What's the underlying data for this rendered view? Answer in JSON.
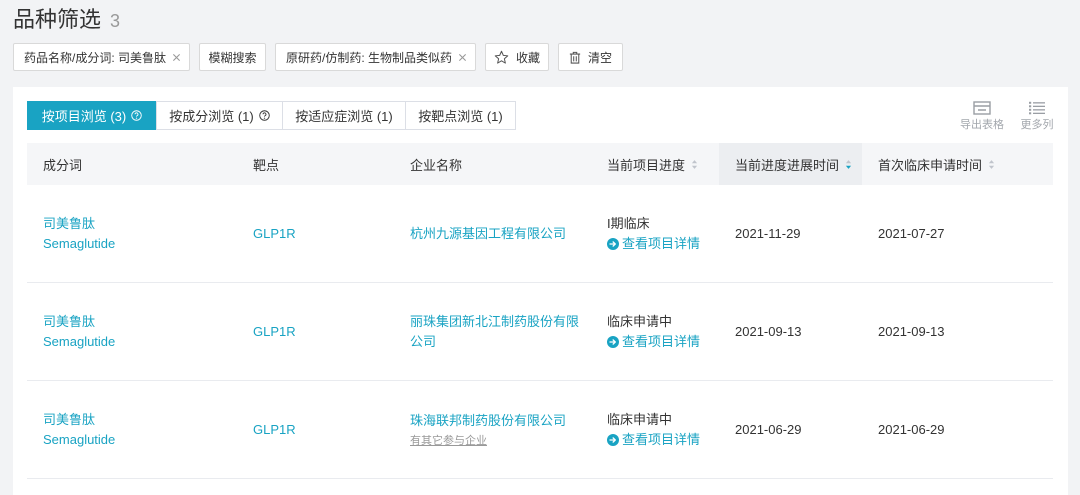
{
  "header": {
    "title": "品种筛选",
    "count": "3"
  },
  "filters": {
    "drug_name": {
      "label": "药品名称/成分词: 司美鲁肽"
    },
    "fuzzy_search_label": "模糊搜索",
    "originator_generic": {
      "label": "原研药/仿制药: 生物制品类似药"
    },
    "favorite_label": "收藏",
    "clear_label": "清空"
  },
  "tabs": [
    {
      "label": "按项目浏览 (3)",
      "active": true
    },
    {
      "label": "按成分浏览 (1)",
      "active": false
    },
    {
      "label": "按适应症浏览 (1)",
      "active": false
    },
    {
      "label": "按靶点浏览 (1)",
      "active": false
    }
  ],
  "tools": {
    "export_label": "导出表格",
    "more_columns_label": "更多列"
  },
  "table": {
    "columns": [
      {
        "label": "成分词",
        "sortable": false
      },
      {
        "label": "靶点",
        "sortable": false
      },
      {
        "label": "企业名称",
        "sortable": false
      },
      {
        "label": "当前项目进度",
        "sortable": true,
        "sorted_desc": false
      },
      {
        "label": "当前进度进展时间",
        "sortable": true,
        "sorted_desc": true
      },
      {
        "label": "首次临床申请时间",
        "sortable": true,
        "sorted_desc": false
      }
    ],
    "rows": [
      {
        "name_cn": "司美鲁肽",
        "name_en": "Semaglutide",
        "target": "GLP1R",
        "company": "杭州九源基因工程有限公司",
        "progress": "I期临床",
        "detail_link": "查看项目详情",
        "progress_date": "2021-11-29",
        "first_application_date": "2021-07-27"
      },
      {
        "name_cn": "司美鲁肽",
        "name_en": "Semaglutide",
        "target": "GLP1R",
        "company": "丽珠集团新北江制药股份有限公司",
        "progress": "临床申请中",
        "detail_link": "查看项目详情",
        "progress_date": "2021-09-13",
        "first_application_date": "2021-09-13"
      },
      {
        "name_cn": "司美鲁肽",
        "name_en": "Semaglutide",
        "target": "GLP1R",
        "company": "珠海联邦制药股份有限公司",
        "company_note": "有其它参与企业",
        "progress": "临床申请中",
        "detail_link": "查看项目详情",
        "progress_date": "2021-06-29",
        "first_application_date": "2021-06-29"
      }
    ]
  },
  "colors": {
    "accent": "#19a3c3",
    "text": "#333333",
    "muted": "#999999",
    "page_background": "#f2f3f5",
    "header_background": "#f5f6f8"
  },
  "icons": {
    "remove_filter": "close-icon",
    "favorite": "star-icon",
    "clear": "trash-icon",
    "tab_help": "help-icon",
    "export": "export-icon",
    "more_columns": "list-icon",
    "sort": "sort-icon",
    "detail": "arrow-circle-right-icon"
  }
}
